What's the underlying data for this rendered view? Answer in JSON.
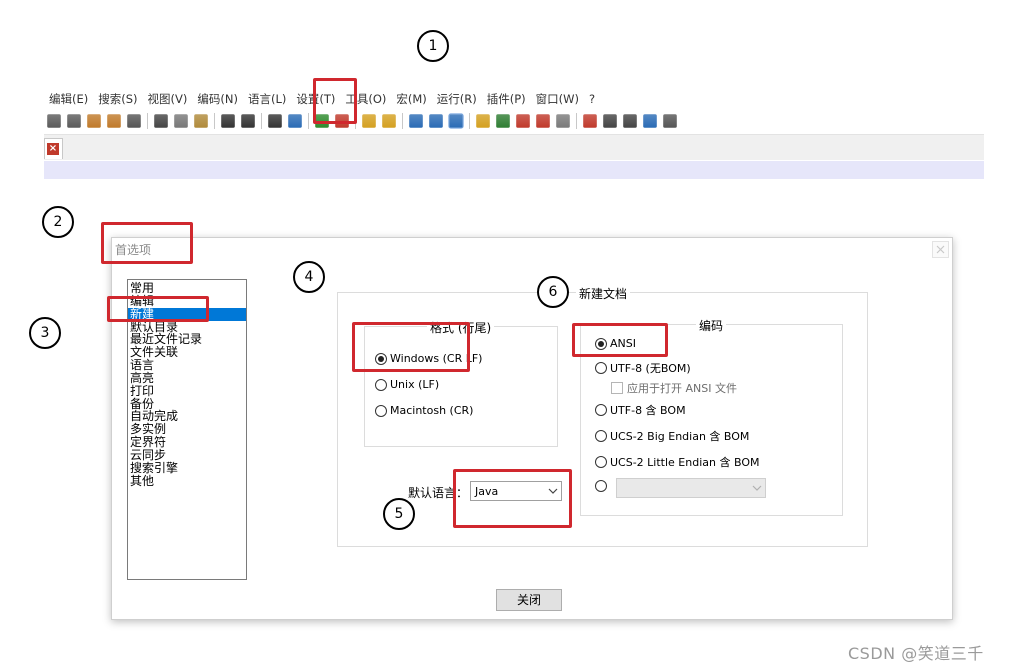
{
  "annotations": [
    "1",
    "2",
    "3",
    "4",
    "5",
    "6"
  ],
  "menubar": {
    "items": [
      "编辑(E)",
      "搜索(S)",
      "视图(V)",
      "编码(N)",
      "语言(L)",
      "设置(T)",
      "工具(O)",
      "宏(M)",
      "运行(R)",
      "插件(P)",
      "窗口(W)",
      "?"
    ]
  },
  "toolbar": {
    "icons": [
      {
        "name": "save-icon",
        "color": "#5a5a5a"
      },
      {
        "name": "save-all-icon",
        "color": "#5a5a5a"
      },
      {
        "name": "close-file-icon",
        "color": "#c07a2a"
      },
      {
        "name": "close-all-icon",
        "color": "#c07a2a"
      },
      {
        "name": "print-icon",
        "color": "#555555"
      },
      {
        "name": "cut-icon",
        "color": "#444444"
      },
      {
        "name": "copy-icon",
        "color": "#777777"
      },
      {
        "name": "paste-icon",
        "color": "#b08a3a"
      },
      {
        "name": "undo-icon",
        "color": "#333333"
      },
      {
        "name": "redo-icon",
        "color": "#333333"
      },
      {
        "name": "find-icon",
        "color": "#333333"
      },
      {
        "name": "replace-icon",
        "color": "#2a6bb5"
      },
      {
        "name": "zoom-in-icon",
        "color": "#2e8b2e"
      },
      {
        "name": "zoom-out-icon",
        "color": "#c0392b"
      },
      {
        "name": "sync-vertical-icon",
        "color": "#d4a020"
      },
      {
        "name": "sync-horizontal-icon",
        "color": "#d4a020"
      },
      {
        "name": "word-wrap-icon",
        "color": "#2a6bb5"
      },
      {
        "name": "show-all-chars-icon",
        "color": "#2a6bb5"
      },
      {
        "name": "indent-guide-icon",
        "color": "#2a6bb5"
      },
      {
        "name": "language-define-icon",
        "color": "#d4a020"
      },
      {
        "name": "doc-map-icon",
        "color": "#2e7d32"
      },
      {
        "name": "function-list-icon",
        "color": "#c0392b"
      },
      {
        "name": "folder-workspace-icon",
        "color": "#c0392b"
      },
      {
        "name": "monitoring-icon",
        "color": "#7a7a7a"
      },
      {
        "name": "record-macro-icon",
        "color": "#c0392b"
      },
      {
        "name": "stop-macro-icon",
        "color": "#444444"
      },
      {
        "name": "play-macro-icon",
        "color": "#444444"
      },
      {
        "name": "run-macro-multiple-icon",
        "color": "#2a6bb5"
      },
      {
        "name": "save-macro-icon",
        "color": "#555555"
      }
    ]
  },
  "dialog": {
    "title": "首选项",
    "categories": [
      "常用",
      "编辑",
      "新建",
      "默认目录",
      "最近文件记录",
      "文件关联",
      "语言",
      "高亮",
      "打印",
      "备份",
      "自动完成",
      "多实例",
      "定界符",
      "云同步",
      "搜索引擎",
      "其他"
    ],
    "selected_category": "新建",
    "newdoc": {
      "title": "新建文档",
      "format": {
        "title": "格式 (行尾)",
        "options": [
          "Windows (CR LF)",
          "Unix (LF)",
          "Macintosh (CR)"
        ],
        "selected": "Windows (CR LF)"
      },
      "encoding": {
        "title": "编码",
        "options": [
          "ANSI",
          "UTF-8 (无BOM)",
          "UTF-8 含 BOM",
          "UCS-2 Big Endian 含 BOM",
          "UCS-2 Little Endian 含 BOM"
        ],
        "selected": "ANSI",
        "apply_checkbox_label": "应用于打开 ANSI 文件",
        "extra_select_value": ""
      },
      "default_language": {
        "label": "默认语言：",
        "value": "Java"
      }
    },
    "close_label": "关闭"
  },
  "watermark": "CSDN @笑道三千",
  "colors": {
    "highlight_red": "#d0282e",
    "selection_blue": "#0078d7"
  }
}
